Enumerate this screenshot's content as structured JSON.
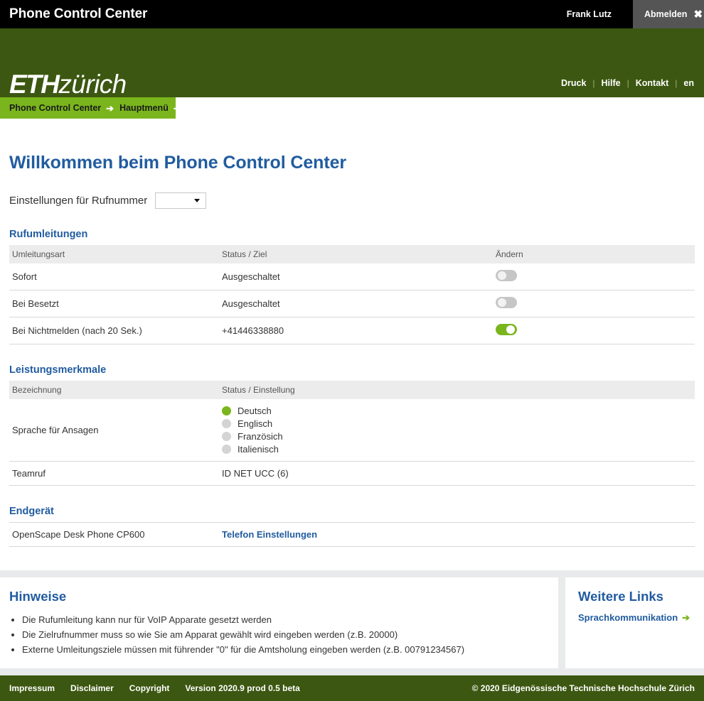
{
  "appbar": {
    "title": "Phone Control Center",
    "user": "Frank Lutz",
    "logout_label": "Abmelden",
    "logout_icon": "close-icon",
    "close_glyph": "✖"
  },
  "brand": {
    "logo_bold": "ETH",
    "logo_light": "zürich",
    "nav": [
      {
        "label": "Druck"
      },
      {
        "label": "Hilfe"
      },
      {
        "label": "Kontakt"
      },
      {
        "label": "en"
      }
    ],
    "separator": "|"
  },
  "breadcrumb": {
    "items": [
      {
        "label": "Phone Control Center"
      },
      {
        "label": "Hauptmenü"
      }
    ],
    "arrow_glyph": "➔"
  },
  "page": {
    "title": "Willkommen beim Phone Control Center",
    "number_label": "Einstellungen für Rufnummer",
    "number_value": "",
    "number_placeholder": ""
  },
  "forwarding": {
    "section_title": "Rufumleitungen",
    "headers": [
      "Umleitungsart",
      "Status / Ziel",
      "Ändern"
    ],
    "rows": [
      {
        "type": "Sofort",
        "status": "Ausgeschaltet",
        "toggle": "off"
      },
      {
        "type": "Bei Besetzt",
        "status": "Ausgeschaltet",
        "toggle": "off"
      },
      {
        "type": "Bei Nichtmelden (nach 20 Sek.)",
        "status": "+41446338880",
        "toggle": "on"
      }
    ]
  },
  "features": {
    "section_title": "Leistungsmerkmale",
    "headers": [
      "Bezeichnung",
      "Status / Einstellung"
    ],
    "language_row_label": "Sprache für Ansagen",
    "language_options": [
      {
        "label": "Deutsch",
        "selected": true
      },
      {
        "label": "Englisch",
        "selected": false
      },
      {
        "label": "Französich",
        "selected": false
      },
      {
        "label": "Italienisch",
        "selected": false
      }
    ],
    "teamruf_label": "Teamruf",
    "teamruf_value": "ID NET UCC (6)"
  },
  "device": {
    "section_title": "Endgerät",
    "name": "OpenScape Desk Phone CP600",
    "settings_link": "Telefon Einstellungen"
  },
  "hints": {
    "title": "Hinweise",
    "items": [
      "Die Rufumleitung kann nur für VoIP Apparate gesetzt werden",
      "Die Zielrufnummer muss so wie Sie am Apparat gewählt wird eingeben werden (z.B. 20000)",
      "Externe Umleitungsziele müssen mit führender \"0\" für die Amtsholung eingeben werden (z.B. 00791234567)"
    ]
  },
  "more_links": {
    "title": "Weitere Links",
    "items": [
      {
        "label": "Sprachkommunikation",
        "arrow": "➔"
      }
    ]
  },
  "footer": {
    "links": [
      {
        "label": "Impressum"
      },
      {
        "label": "Disclaimer"
      },
      {
        "label": "Copyright"
      }
    ],
    "version": "Version 2020.9 prod 0.5 beta",
    "copyright": "© 2020 Eidgenössische Technische Hochschule Zürich"
  },
  "colors": {
    "dark_green": "#3c5711",
    "light_green": "#7ab51d",
    "link_blue": "#215ca0",
    "black_bar": "#000000",
    "table_header": "#ececec",
    "band_gray": "#e9eaeb"
  }
}
